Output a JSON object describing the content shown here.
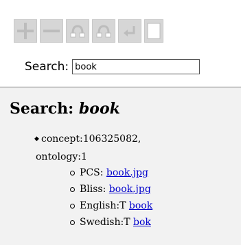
{
  "toolbar": {
    "buttons": [
      {
        "icon": "plus-icon"
      },
      {
        "icon": "minus-icon"
      },
      {
        "icon": "link-up-left-icon"
      },
      {
        "icon": "link-up-right-icon"
      },
      {
        "icon": "enter-arrow-icon"
      },
      {
        "icon": "blank-page-icon"
      }
    ],
    "icon_color": "#bcbcbc",
    "button_bg": "#d6d6d6"
  },
  "search": {
    "label": "Search:",
    "value": "book"
  },
  "result": {
    "heading_prefix": "Search:",
    "heading_term": "book",
    "concept_line1": "concept:106325082,",
    "concept_line2": "ontology:1",
    "items": [
      {
        "label": "PCS:",
        "link": "book.jpg"
      },
      {
        "label": "Bliss:",
        "link": "book.jpg"
      },
      {
        "label": "English:T",
        "link": "book"
      },
      {
        "label": "Swedish:T",
        "link": "bok"
      }
    ],
    "link_color": "#0000cc",
    "panel_bg": "#f2f2f2"
  }
}
